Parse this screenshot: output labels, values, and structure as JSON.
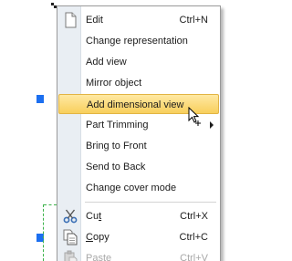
{
  "context_menu": {
    "items": [
      {
        "label": "Edit",
        "shortcut": "Ctrl+N",
        "icon": "document-icon"
      },
      {
        "label": "Change representation"
      },
      {
        "label": "Add view"
      },
      {
        "label": "Mirror object"
      },
      {
        "label": "Add dimensional view",
        "highlighted": true
      },
      {
        "label": "Part Trimming",
        "has_submenu": true
      },
      {
        "label": "Bring to Front"
      },
      {
        "label": "Send to Back"
      },
      {
        "label": "Change cover mode"
      },
      {
        "label_pre": "Cu",
        "label_ul": "t",
        "shortcut": "Ctrl+X",
        "icon": "scissors-icon"
      },
      {
        "label_pre": "",
        "label_ul": "C",
        "label_post": "opy",
        "shortcut": "Ctrl+C",
        "icon": "copy-icon"
      },
      {
        "label_pre": "",
        "label_ul": "P",
        "label_post": "aste",
        "shortcut": "Ctrl+V",
        "icon": "paste-icon",
        "disabled": true
      }
    ]
  },
  "colors": {
    "highlight_top": "#ffe9a3",
    "highlight_bottom": "#f8cf5c",
    "handle": "#1c6ff0",
    "dashed_line": "#3cb34a"
  }
}
